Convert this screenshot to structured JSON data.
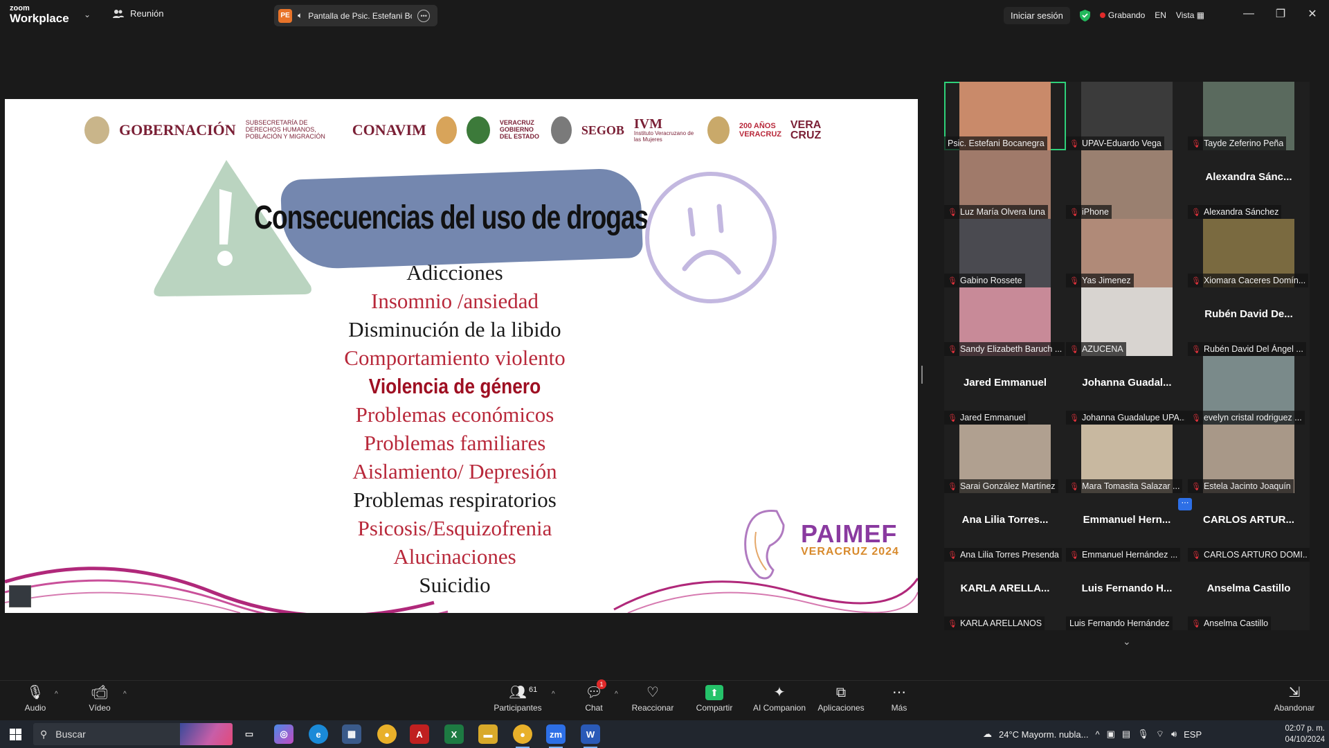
{
  "topbar": {
    "logo_line1": "zoom",
    "logo_line2": "Workplace",
    "meeting_label": "Reunión",
    "share_badge": "PE",
    "share_title": "Pantalla de Psic. Estefani Bocanegra",
    "signin": "Iniciar sesión",
    "recording": "Grabando",
    "language": "EN",
    "view": "Vista"
  },
  "slide": {
    "logos": {
      "gobernacion": "GOBERNACIÓN",
      "subsecretaria": "SUBSECRETARÍA DE DERECHOS HUMANOS, POBLACIÓN Y MIGRACIÓN",
      "conavim": "CONAVIM",
      "veracruz": "VERACRUZ GOBIERNO DEL ESTADO",
      "segob": "SEGOB",
      "ivm": "IVM",
      "ivm_sub": "Instituto Veracruzano de las Mujeres",
      "aniv": "200 AÑOS VERACRUZ",
      "veracruz2": "VERA CRUZ"
    },
    "title": "Consecuencias del uso de drogas",
    "items": [
      {
        "text": "Adicciones",
        "style": "dark"
      },
      {
        "text": "Insomnio /ansiedad",
        "style": "red"
      },
      {
        "text": "Disminución de la libido",
        "style": "dark"
      },
      {
        "text": "Comportamiento violento",
        "style": "red"
      },
      {
        "text": "Violencia de género",
        "style": "bold"
      },
      {
        "text": "Problemas económicos",
        "style": "red"
      },
      {
        "text": "Problemas familiares",
        "style": "red"
      },
      {
        "text": "Aislamiento/ Depresión",
        "style": "red"
      },
      {
        "text": "Problemas respiratorios",
        "style": "dark"
      },
      {
        "text": "Psicosis/Esquizofrenia",
        "style": "red"
      },
      {
        "text": "Alucinaciones",
        "style": "red"
      },
      {
        "text": "Suicidio",
        "style": "dark"
      }
    ],
    "paimef_title": "PAIMEF",
    "paimef_sub": "VERACRUZ 2024"
  },
  "gallery": {
    "tiles": [
      {
        "big": "",
        "caption": "Psic. Estefani Bocanegra",
        "muted": false,
        "video": "#c98a6a",
        "active": true
      },
      {
        "big": "",
        "caption": "UPAV-Eduardo Vega",
        "muted": true,
        "video": "#3b3b3b"
      },
      {
        "big": "",
        "caption": "Tayde Zeferino Peña",
        "muted": true,
        "video": "#5a6a5e"
      },
      {
        "big": "",
        "caption": "Luz María Olvera luna",
        "muted": true,
        "video": "#a07a6a"
      },
      {
        "big": "",
        "caption": "iPhone",
        "muted": true,
        "video": "#9a8070"
      },
      {
        "big": "Alexandra Sánc...",
        "caption": "Alexandra Sánchez",
        "muted": true,
        "video": ""
      },
      {
        "big": "",
        "caption": "Gabino Rossete",
        "muted": true,
        "video": "#4a4a50"
      },
      {
        "big": "",
        "caption": "Yas Jimenez",
        "muted": true,
        "video": "#b08a78"
      },
      {
        "big": "",
        "caption": "Xiomara Caceres Domín...",
        "muted": true,
        "video": "#7a6a40"
      },
      {
        "big": "",
        "caption": "Sandy Elizabeth Baruch ...",
        "muted": true,
        "video": "#c88a98"
      },
      {
        "big": "",
        "caption": "AZUCENA",
        "muted": true,
        "video": "#d8d4d0"
      },
      {
        "big": "Rubén David De...",
        "caption": "Rubén David Del Ángel ...",
        "muted": true,
        "video": ""
      },
      {
        "big": "Jared Emmanuel",
        "caption": "Jared Emmanuel",
        "muted": true,
        "video": ""
      },
      {
        "big": "Johanna Guadal...",
        "caption": "Johanna Guadalupe UPA...",
        "muted": true,
        "video": ""
      },
      {
        "big": "",
        "caption": "evelyn cristal rodriguez ...",
        "muted": true,
        "video": "#7a8a8a"
      },
      {
        "big": "",
        "caption": "Sarai González Martínez",
        "muted": true,
        "video": "#b0a090"
      },
      {
        "big": "",
        "caption": "Mara Tomasita Salazar ...",
        "muted": true,
        "video": "#c8b8a0"
      },
      {
        "big": "",
        "caption": "Estela Jacinto Joaquín",
        "muted": true,
        "video": "#a89888"
      },
      {
        "big": "Ana Lilia Torres...",
        "caption": "Ana Lilia Torres Presenda",
        "muted": true,
        "video": ""
      },
      {
        "big": "Emmanuel Hern...",
        "caption": "Emmanuel Hernández ...",
        "muted": true,
        "video": ""
      },
      {
        "big": "CARLOS ARTUR...",
        "caption": "CARLOS ARTURO DOMI...",
        "muted": true,
        "video": ""
      },
      {
        "big": "KARLA ARELLA...",
        "caption": "KARLA ARELLANOS",
        "muted": true,
        "video": ""
      },
      {
        "big": "Luis Fernando H...",
        "caption": "Luis Fernando Hernández",
        "muted": false,
        "video": ""
      },
      {
        "big": "Anselma Castillo",
        "caption": "Anselma Castillo",
        "muted": true,
        "video": ""
      }
    ]
  },
  "toolbar": {
    "audio": "Audio",
    "video": "Vídeo",
    "participants": "Participantes",
    "participants_count": "61",
    "chat": "Chat",
    "chat_badge": "1",
    "react": "Reaccionar",
    "share": "Compartir",
    "ai": "AI Companion",
    "apps": "Aplicaciones",
    "more": "Más",
    "leave": "Abandonar"
  },
  "taskbar": {
    "search": "Buscar",
    "weather": "24°C  Mayorm. nubla...",
    "lang": "ESP",
    "time": "02:07 p. m.",
    "date": "04/10/2024"
  }
}
